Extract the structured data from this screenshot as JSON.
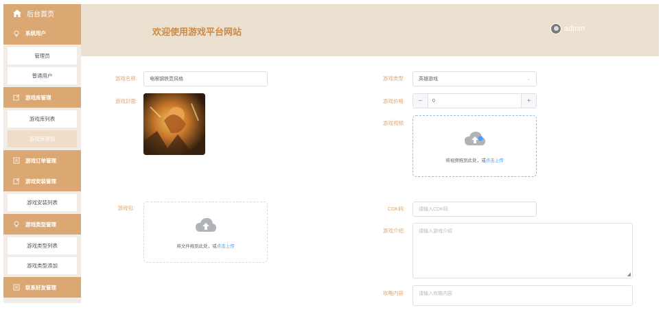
{
  "sidebar": {
    "home_label": "后台首页",
    "groups": {
      "system_users": "系统用户",
      "game_library": "游戏库管理",
      "game_orders": "游戏订单管理",
      "game_install": "游戏安装管理",
      "game_types": "游戏类型管理",
      "contact": "联系好友管理"
    },
    "items": {
      "admin": "管理员",
      "normal_user": "普通用户",
      "library_list": "游戏库列表",
      "library_add": "游戏库添加",
      "install_list": "游戏安装列表",
      "type_list": "游戏类型列表",
      "type_add": "游戏类型添加"
    }
  },
  "header": {
    "title": "欢迎使用游戏平台网站",
    "username": "admin"
  },
  "form": {
    "name_label": "游戏名称:",
    "name_value": "电眼钢铁壶风格",
    "type_label": "游戏类型:",
    "type_value": "英雄游戏",
    "cover_label": "游戏封面:",
    "price_label": "游戏价格:",
    "price_value": "0",
    "price_minus": "−",
    "price_plus": "+",
    "video_label": "游戏视频:",
    "video_upload_text": "将视频拖到此处，或",
    "video_upload_link": "点击上传",
    "package_label": "游戏包:",
    "package_upload_text": "将文件拖到此处，或",
    "package_upload_link": "点击上传",
    "cdk_label": "CDK码:",
    "cdk_placeholder": "请输入CDK码",
    "intro_label": "游戏介绍:",
    "intro_placeholder": "请输入游戏介绍",
    "guide_label": "攻略内容:",
    "guide_placeholder": "请输入攻略内容"
  },
  "colors": {
    "accent": "#dba874",
    "header_bg": "#ece0d0",
    "title": "#cd8a45",
    "link": "#409eff"
  }
}
